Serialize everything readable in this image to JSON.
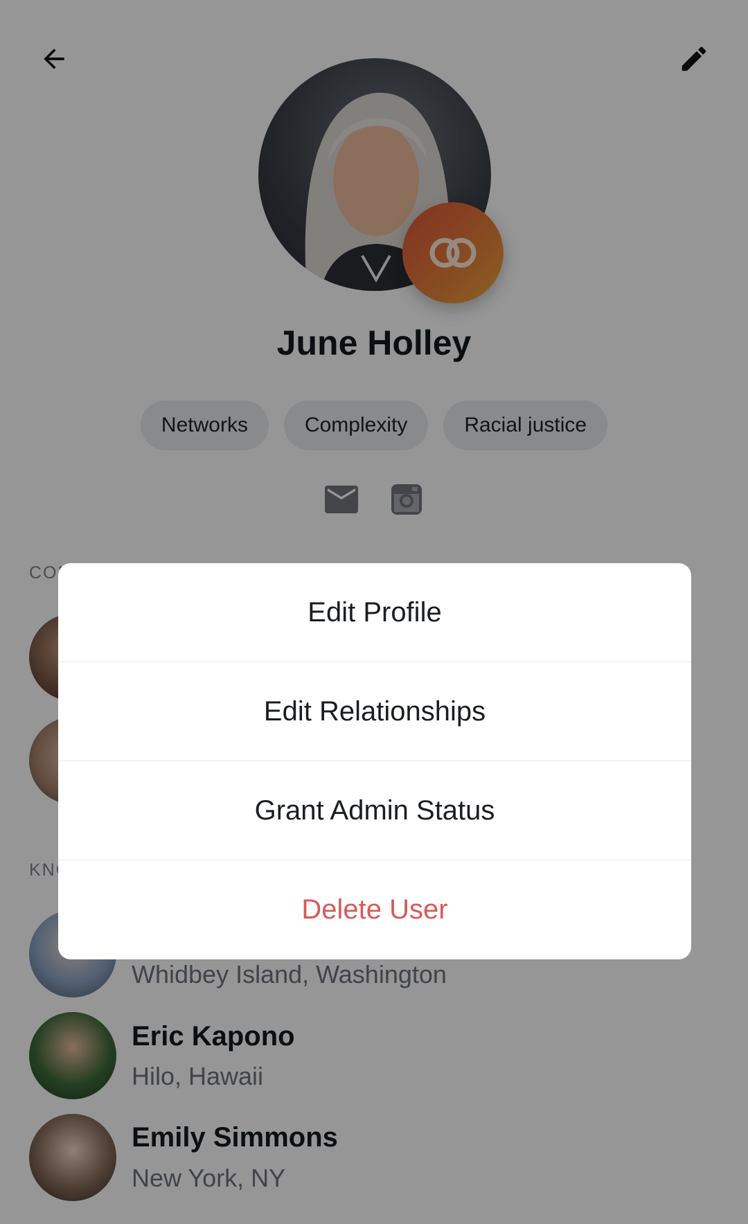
{
  "profile": {
    "name": "June Holley",
    "tags": [
      "Networks",
      "Complexity",
      "Racial justice"
    ]
  },
  "icons": {
    "back": "arrow-left-icon",
    "edit": "pencil-icon",
    "badge": "interlocking-rings-icon",
    "email": "mail-icon",
    "instagram": "instagram-icon"
  },
  "sections": {
    "connections_label": "CON",
    "known_label": "KNO"
  },
  "people": [
    {
      "name": "",
      "location": "Whidbey Island, Washington"
    },
    {
      "name": "Eric Kapono",
      "location": "Hilo, Hawaii"
    },
    {
      "name": "Emily Simmons",
      "location": "New York, NY"
    }
  ],
  "menu": {
    "edit_profile": "Edit Profile",
    "edit_relationships": "Edit Relationships",
    "grant_admin": "Grant Admin Status",
    "delete_user": "Delete User"
  },
  "colors": {
    "danger": "#d65a5a",
    "badge_start": "#d8553a",
    "badge_end": "#e7a03a",
    "overlay": "rgba(0,0,0,0.40)"
  }
}
